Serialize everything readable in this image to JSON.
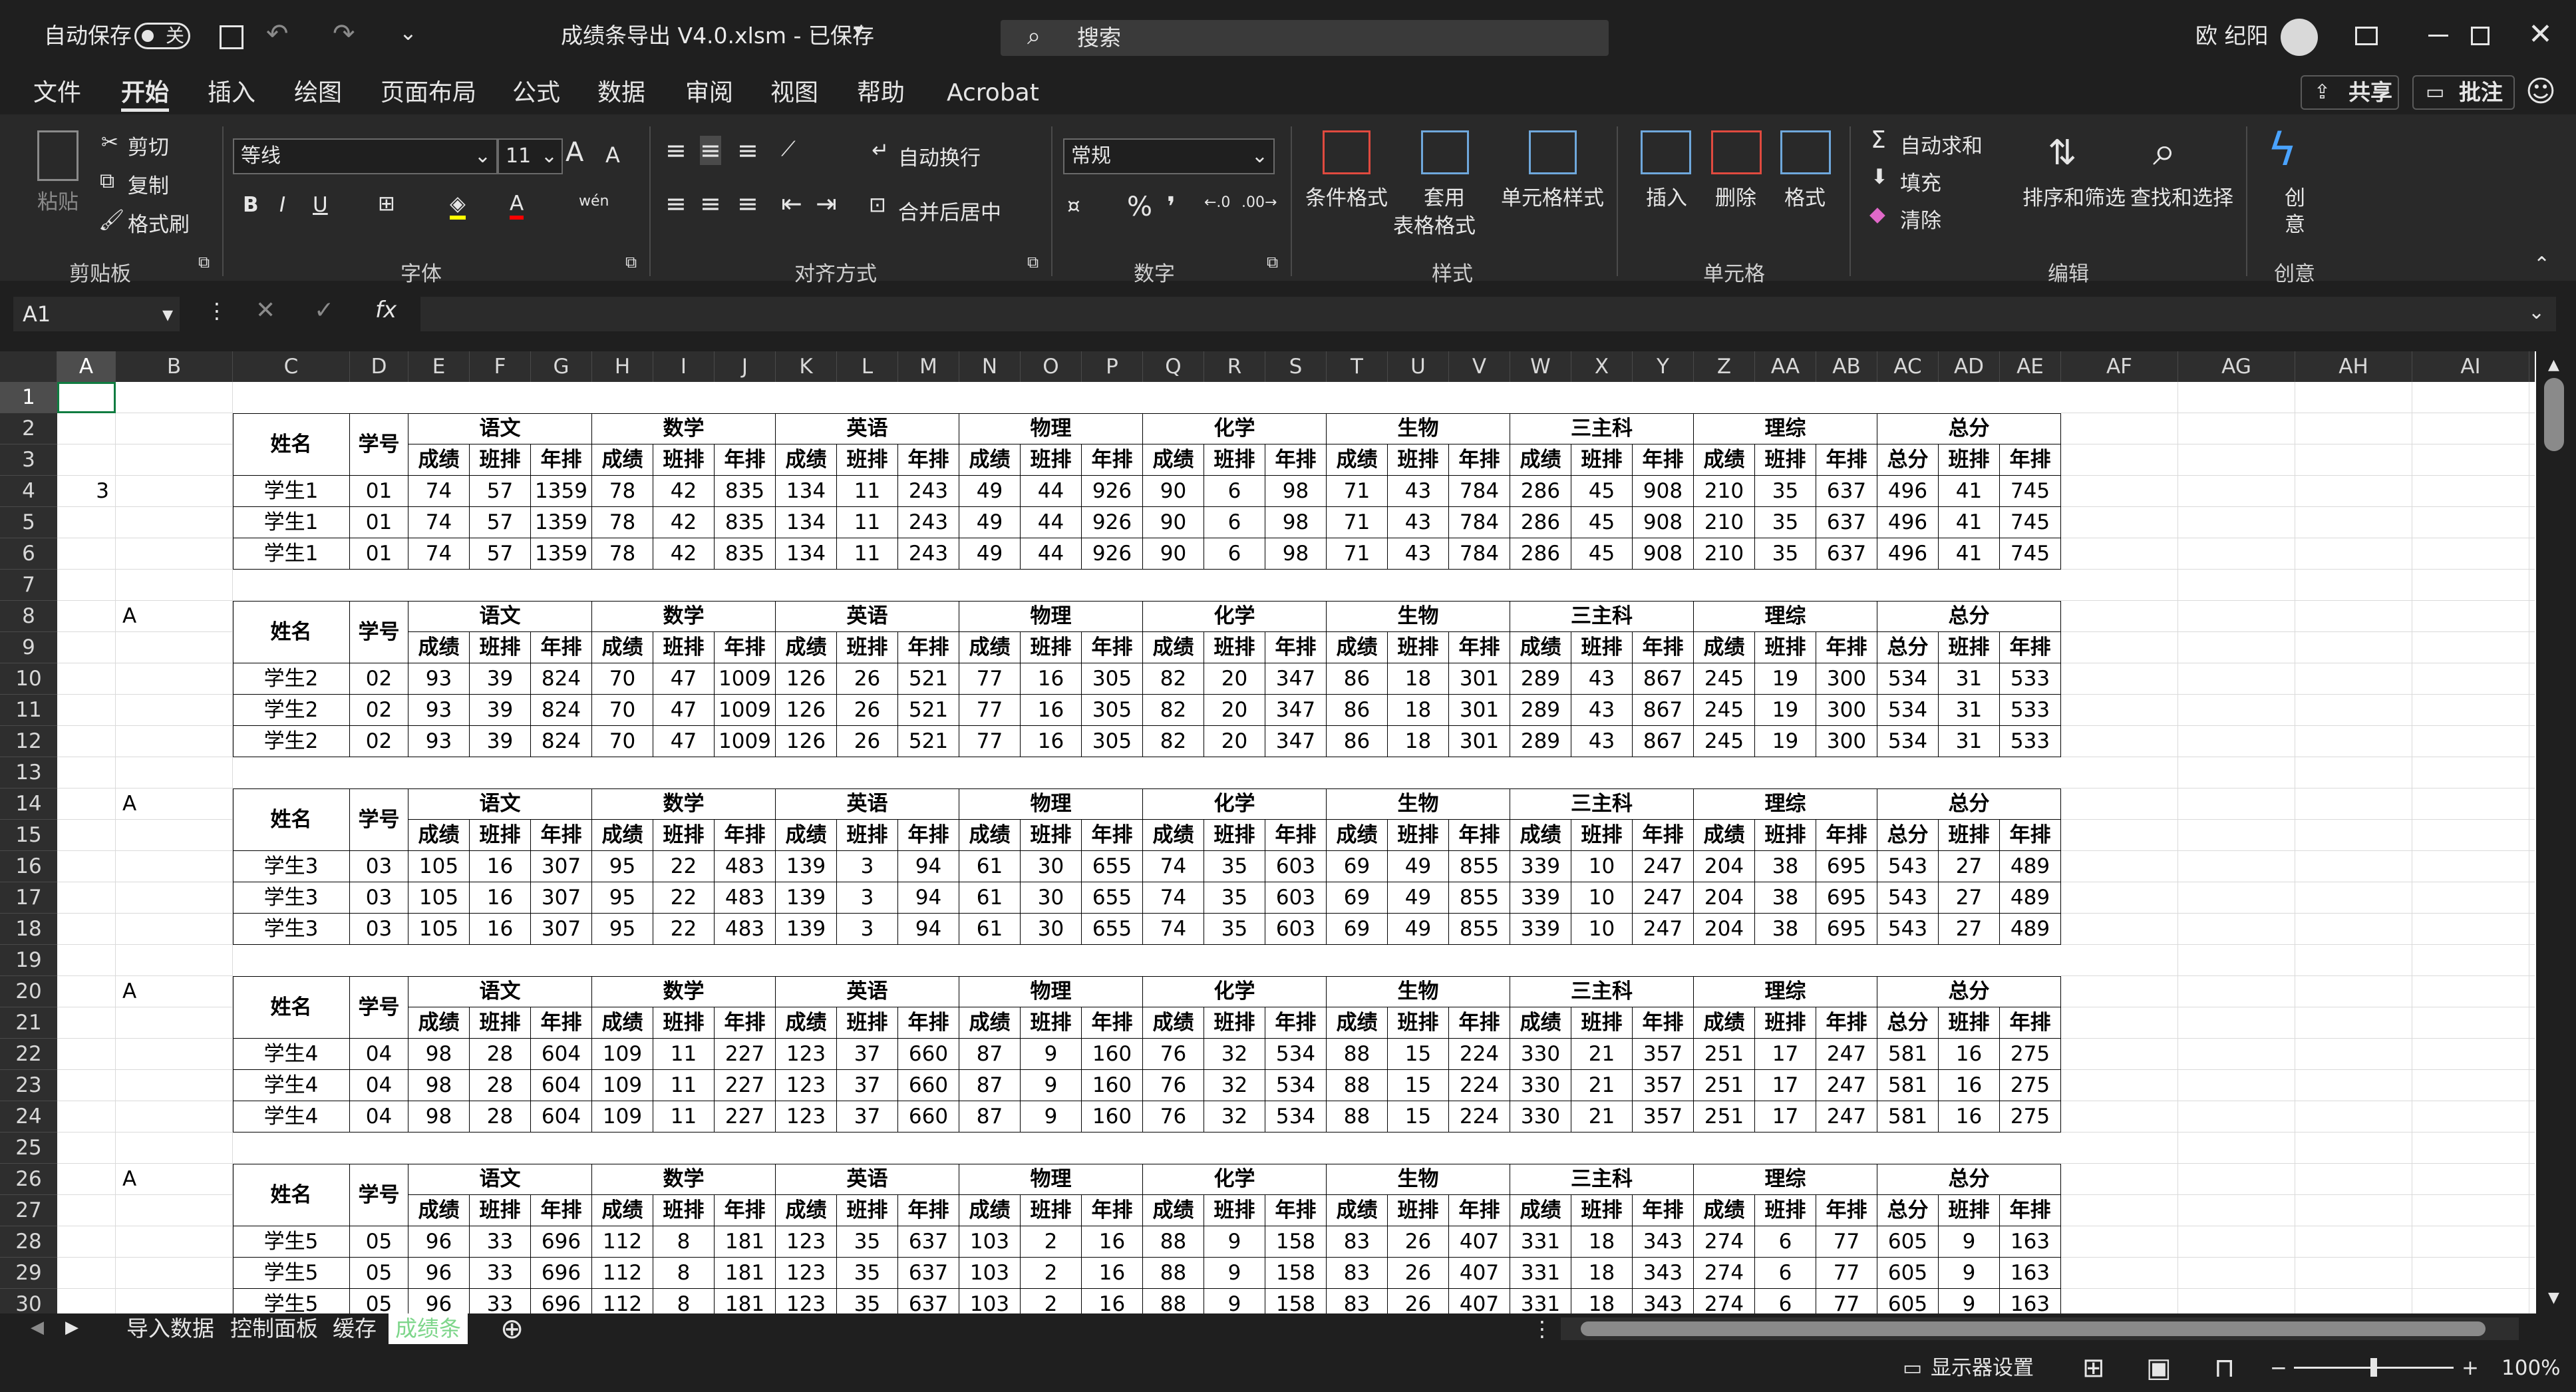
{
  "titlebar": {
    "autosave_label": "自动保存",
    "autosave_state": "关",
    "filename": "成绩条导出 V4.0.xlsm - 已保存",
    "search_placeholder": "搜索",
    "user": "欧 纪阳"
  },
  "menu": [
    "文件",
    "开始",
    "插入",
    "绘图",
    "页面布局",
    "公式",
    "数据",
    "审阅",
    "视图",
    "帮助",
    "Acrobat"
  ],
  "menu_right": {
    "share": "共享",
    "comment": "批注"
  },
  "ribbon": {
    "clipboard": {
      "paste": "粘贴",
      "cut": "剪切",
      "copy": "复制",
      "format_painter": "格式刷",
      "group": "剪贴板"
    },
    "font": {
      "name": "等线",
      "size": "11",
      "group": "字体",
      "grow": "A",
      "shrink": "A"
    },
    "alignment": {
      "wrap": "自动换行",
      "merge": "合并后居中",
      "group": "对齐方式"
    },
    "number": {
      "format": "常规",
      "group": "数字"
    },
    "styles": {
      "conditional": "条件格式",
      "table_line1": "套用",
      "table_line2": "表格格式",
      "cell_styles": "单元格样式",
      "group": "样式"
    },
    "cells": {
      "insert": "插入",
      "delete": "删除",
      "format": "格式",
      "group": "单元格"
    },
    "editing": {
      "autosum": "自动求和",
      "fill": "填充",
      "clear": "清除",
      "sort": "排序和筛选",
      "find": "查找和选择",
      "group": "编辑"
    },
    "creative": {
      "line1": "创",
      "line2": "意",
      "group": "创意"
    }
  },
  "formula_bar": {
    "name_box": "A1",
    "fx": "fx",
    "formula": ""
  },
  "columns": [
    "A",
    "B",
    "C",
    "D",
    "E",
    "F",
    "G",
    "H",
    "I",
    "J",
    "K",
    "L",
    "M",
    "N",
    "O",
    "P",
    "Q",
    "R",
    "S",
    "T",
    "U",
    "V",
    "W",
    "X",
    "Y",
    "Z",
    "AA",
    "AB",
    "AC",
    "AD",
    "AE",
    "AF",
    "AG",
    "AH",
    "AI"
  ],
  "row_numbers": [
    "1",
    "2",
    "3",
    "4",
    "5",
    "6",
    "7",
    "8",
    "9",
    "10",
    "11",
    "12",
    "13",
    "14",
    "15",
    "16",
    "17",
    "18",
    "19",
    "20",
    "21",
    "22",
    "23",
    "24",
    "25",
    "26",
    "27",
    "28",
    "29",
    "30"
  ],
  "header": {
    "name": "姓名",
    "id": "学号",
    "subjects": [
      "语文",
      "数学",
      "英语",
      "物理",
      "化学",
      "生物",
      "三主科",
      "理综",
      "总分"
    ],
    "sub": [
      "成绩",
      "班排",
      "年排"
    ],
    "total_sub": [
      "总分",
      "班排",
      "年排"
    ]
  },
  "blocks": [
    {
      "marker": "3",
      "rows": [
        [
          "学生1",
          "01",
          "74",
          "57",
          "1359",
          "78",
          "42",
          "835",
          "134",
          "11",
          "243",
          "49",
          "44",
          "926",
          "90",
          "6",
          "98",
          "71",
          "43",
          "784",
          "286",
          "45",
          "908",
          "210",
          "35",
          "637",
          "496",
          "41",
          "745"
        ],
        [
          "学生1",
          "01",
          "74",
          "57",
          "1359",
          "78",
          "42",
          "835",
          "134",
          "11",
          "243",
          "49",
          "44",
          "926",
          "90",
          "6",
          "98",
          "71",
          "43",
          "784",
          "286",
          "45",
          "908",
          "210",
          "35",
          "637",
          "496",
          "41",
          "745"
        ],
        [
          "学生1",
          "01",
          "74",
          "57",
          "1359",
          "78",
          "42",
          "835",
          "134",
          "11",
          "243",
          "49",
          "44",
          "926",
          "90",
          "6",
          "98",
          "71",
          "43",
          "784",
          "286",
          "45",
          "908",
          "210",
          "35",
          "637",
          "496",
          "41",
          "745"
        ]
      ]
    },
    {
      "marker": "A",
      "rows": [
        [
          "学生2",
          "02",
          "93",
          "39",
          "824",
          "70",
          "47",
          "1009",
          "126",
          "26",
          "521",
          "77",
          "16",
          "305",
          "82",
          "20",
          "347",
          "86",
          "18",
          "301",
          "289",
          "43",
          "867",
          "245",
          "19",
          "300",
          "534",
          "31",
          "533"
        ],
        [
          "学生2",
          "02",
          "93",
          "39",
          "824",
          "70",
          "47",
          "1009",
          "126",
          "26",
          "521",
          "77",
          "16",
          "305",
          "82",
          "20",
          "347",
          "86",
          "18",
          "301",
          "289",
          "43",
          "867",
          "245",
          "19",
          "300",
          "534",
          "31",
          "533"
        ],
        [
          "学生2",
          "02",
          "93",
          "39",
          "824",
          "70",
          "47",
          "1009",
          "126",
          "26",
          "521",
          "77",
          "16",
          "305",
          "82",
          "20",
          "347",
          "86",
          "18",
          "301",
          "289",
          "43",
          "867",
          "245",
          "19",
          "300",
          "534",
          "31",
          "533"
        ]
      ]
    },
    {
      "marker": "A",
      "rows": [
        [
          "学生3",
          "03",
          "105",
          "16",
          "307",
          "95",
          "22",
          "483",
          "139",
          "3",
          "94",
          "61",
          "30",
          "655",
          "74",
          "35",
          "603",
          "69",
          "49",
          "855",
          "339",
          "10",
          "247",
          "204",
          "38",
          "695",
          "543",
          "27",
          "489"
        ],
        [
          "学生3",
          "03",
          "105",
          "16",
          "307",
          "95",
          "22",
          "483",
          "139",
          "3",
          "94",
          "61",
          "30",
          "655",
          "74",
          "35",
          "603",
          "69",
          "49",
          "855",
          "339",
          "10",
          "247",
          "204",
          "38",
          "695",
          "543",
          "27",
          "489"
        ],
        [
          "学生3",
          "03",
          "105",
          "16",
          "307",
          "95",
          "22",
          "483",
          "139",
          "3",
          "94",
          "61",
          "30",
          "655",
          "74",
          "35",
          "603",
          "69",
          "49",
          "855",
          "339",
          "10",
          "247",
          "204",
          "38",
          "695",
          "543",
          "27",
          "489"
        ]
      ]
    },
    {
      "marker": "A",
      "rows": [
        [
          "学生4",
          "04",
          "98",
          "28",
          "604",
          "109",
          "11",
          "227",
          "123",
          "37",
          "660",
          "87",
          "9",
          "160",
          "76",
          "32",
          "534",
          "88",
          "15",
          "224",
          "330",
          "21",
          "357",
          "251",
          "17",
          "247",
          "581",
          "16",
          "275"
        ],
        [
          "学生4",
          "04",
          "98",
          "28",
          "604",
          "109",
          "11",
          "227",
          "123",
          "37",
          "660",
          "87",
          "9",
          "160",
          "76",
          "32",
          "534",
          "88",
          "15",
          "224",
          "330",
          "21",
          "357",
          "251",
          "17",
          "247",
          "581",
          "16",
          "275"
        ],
        [
          "学生4",
          "04",
          "98",
          "28",
          "604",
          "109",
          "11",
          "227",
          "123",
          "37",
          "660",
          "87",
          "9",
          "160",
          "76",
          "32",
          "534",
          "88",
          "15",
          "224",
          "330",
          "21",
          "357",
          "251",
          "17",
          "247",
          "581",
          "16",
          "275"
        ]
      ]
    },
    {
      "marker": "A",
      "rows": [
        [
          "学生5",
          "05",
          "96",
          "33",
          "696",
          "112",
          "8",
          "181",
          "123",
          "35",
          "637",
          "103",
          "2",
          "16",
          "88",
          "9",
          "158",
          "83",
          "26",
          "407",
          "331",
          "18",
          "343",
          "274",
          "6",
          "77",
          "605",
          "9",
          "163"
        ],
        [
          "学生5",
          "05",
          "96",
          "33",
          "696",
          "112",
          "8",
          "181",
          "123",
          "35",
          "637",
          "103",
          "2",
          "16",
          "88",
          "9",
          "158",
          "83",
          "26",
          "407",
          "331",
          "18",
          "343",
          "274",
          "6",
          "77",
          "605",
          "9",
          "163"
        ],
        [
          "学生5",
          "05",
          "96",
          "33",
          "696",
          "112",
          "8",
          "181",
          "123",
          "35",
          "637",
          "103",
          "2",
          "16",
          "88",
          "9",
          "158",
          "83",
          "26",
          "407",
          "331",
          "18",
          "343",
          "274",
          "6",
          "77",
          "605",
          "9",
          "163"
        ]
      ]
    }
  ],
  "sheets": [
    "导入数据",
    "控制面板",
    "缓存",
    "成绩条"
  ],
  "active_sheet": "成绩条",
  "status": {
    "display_settings": "显示器设置",
    "zoom": "100%",
    "zoom_level": 1.0
  },
  "colors": {
    "accent_green": "#7ed68b",
    "selection_green": "#107c41",
    "titlebar": "#1f1f1f",
    "ribbon": "#292929"
  }
}
